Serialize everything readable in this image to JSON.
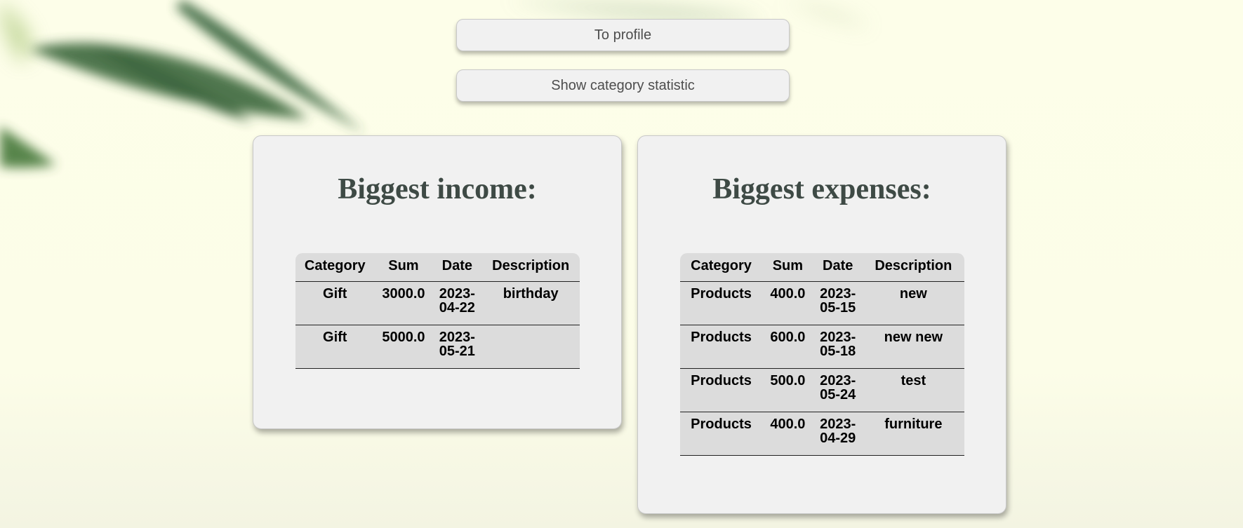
{
  "nav": {
    "profile_label": "To profile",
    "stat_label": "Show category statistic"
  },
  "income": {
    "title": "Biggest income:",
    "headers": [
      "Category",
      "Sum",
      "Date",
      "Description"
    ],
    "rows": [
      {
        "category": "Gift",
        "sum": "3000.0",
        "date": "2023-04-22",
        "description": "birthday"
      },
      {
        "category": "Gift",
        "sum": "5000.0",
        "date": "2023-05-21",
        "description": ""
      }
    ]
  },
  "expenses": {
    "title": "Biggest expenses:",
    "headers": [
      "Category",
      "Sum",
      "Date",
      "Description"
    ],
    "rows": [
      {
        "category": "Products",
        "sum": "400.0",
        "date": "2023-05-15",
        "description": "new"
      },
      {
        "category": "Products",
        "sum": "600.0",
        "date": "2023-05-18",
        "description": "new new"
      },
      {
        "category": "Products",
        "sum": "500.0",
        "date": "2023-05-24",
        "description": "test"
      },
      {
        "category": "Products",
        "sum": "400.0",
        "date": "2023-04-29",
        "description": "furniture"
      }
    ]
  },
  "colors": {
    "background": "#fdfee9",
    "card": "#f1f1f1",
    "table_cell": "#dcdcdc",
    "heading": "#3e4a45",
    "button_text": "#4d4d4d"
  }
}
